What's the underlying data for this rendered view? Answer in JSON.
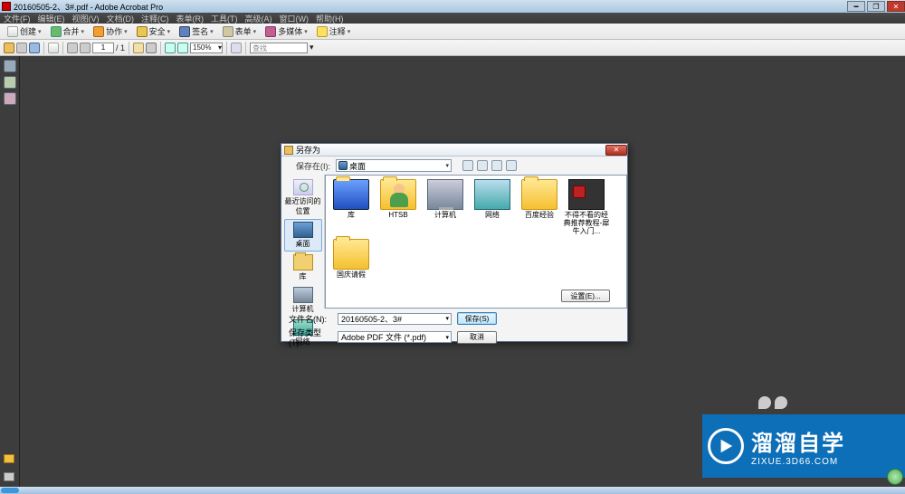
{
  "title": "20160505-2、3#.pdf - Adobe Acrobat Pro",
  "menubar": [
    "文件(F)",
    "编辑(E)",
    "视图(V)",
    "文档(D)",
    "注释(C)",
    "表单(R)",
    "工具(T)",
    "高级(A)",
    "窗口(W)",
    "帮助(H)"
  ],
  "toolbar1": {
    "create": "创建",
    "combine": "合并",
    "collab": "协作",
    "secure": "安全",
    "sign": "签名",
    "forms": "表单",
    "media": "多媒体",
    "comment": "注释"
  },
  "toolbar2": {
    "page_current": "1",
    "page_total": "/ 1",
    "zoom": "150%",
    "find_placeholder": "查找"
  },
  "dialog": {
    "title": "另存为",
    "save_in_label": "保存在(I):",
    "location": "桌面",
    "places": {
      "recent": "最近访问的位置",
      "desktop": "桌面",
      "libraries": "库",
      "computer": "计算机",
      "network": "网络"
    },
    "items": [
      {
        "label": "库",
        "type": "folder-blue"
      },
      {
        "label": "HTSB",
        "type": "user"
      },
      {
        "label": "计算机",
        "type": "monitor"
      },
      {
        "label": "网络",
        "type": "netmon"
      },
      {
        "label": "百度经验",
        "type": "folder"
      },
      {
        "label": "不得不看的经典推荐教程-犀牛入门...",
        "type": "dark-pdf"
      },
      {
        "label": "国庆请假",
        "type": "folder"
      }
    ],
    "filename_label": "文件名(N):",
    "filename_value": "20160505-2、3#",
    "filetype_label": "保存类型(T):",
    "filetype_value": "Adobe PDF 文件 (*.pdf)",
    "save_btn": "保存(S)",
    "cancel_btn": "取消",
    "settings_btn": "设置(E)..."
  },
  "watermark": {
    "big": "溜溜自学",
    "small": "ZIXUE.3D66.COM"
  }
}
